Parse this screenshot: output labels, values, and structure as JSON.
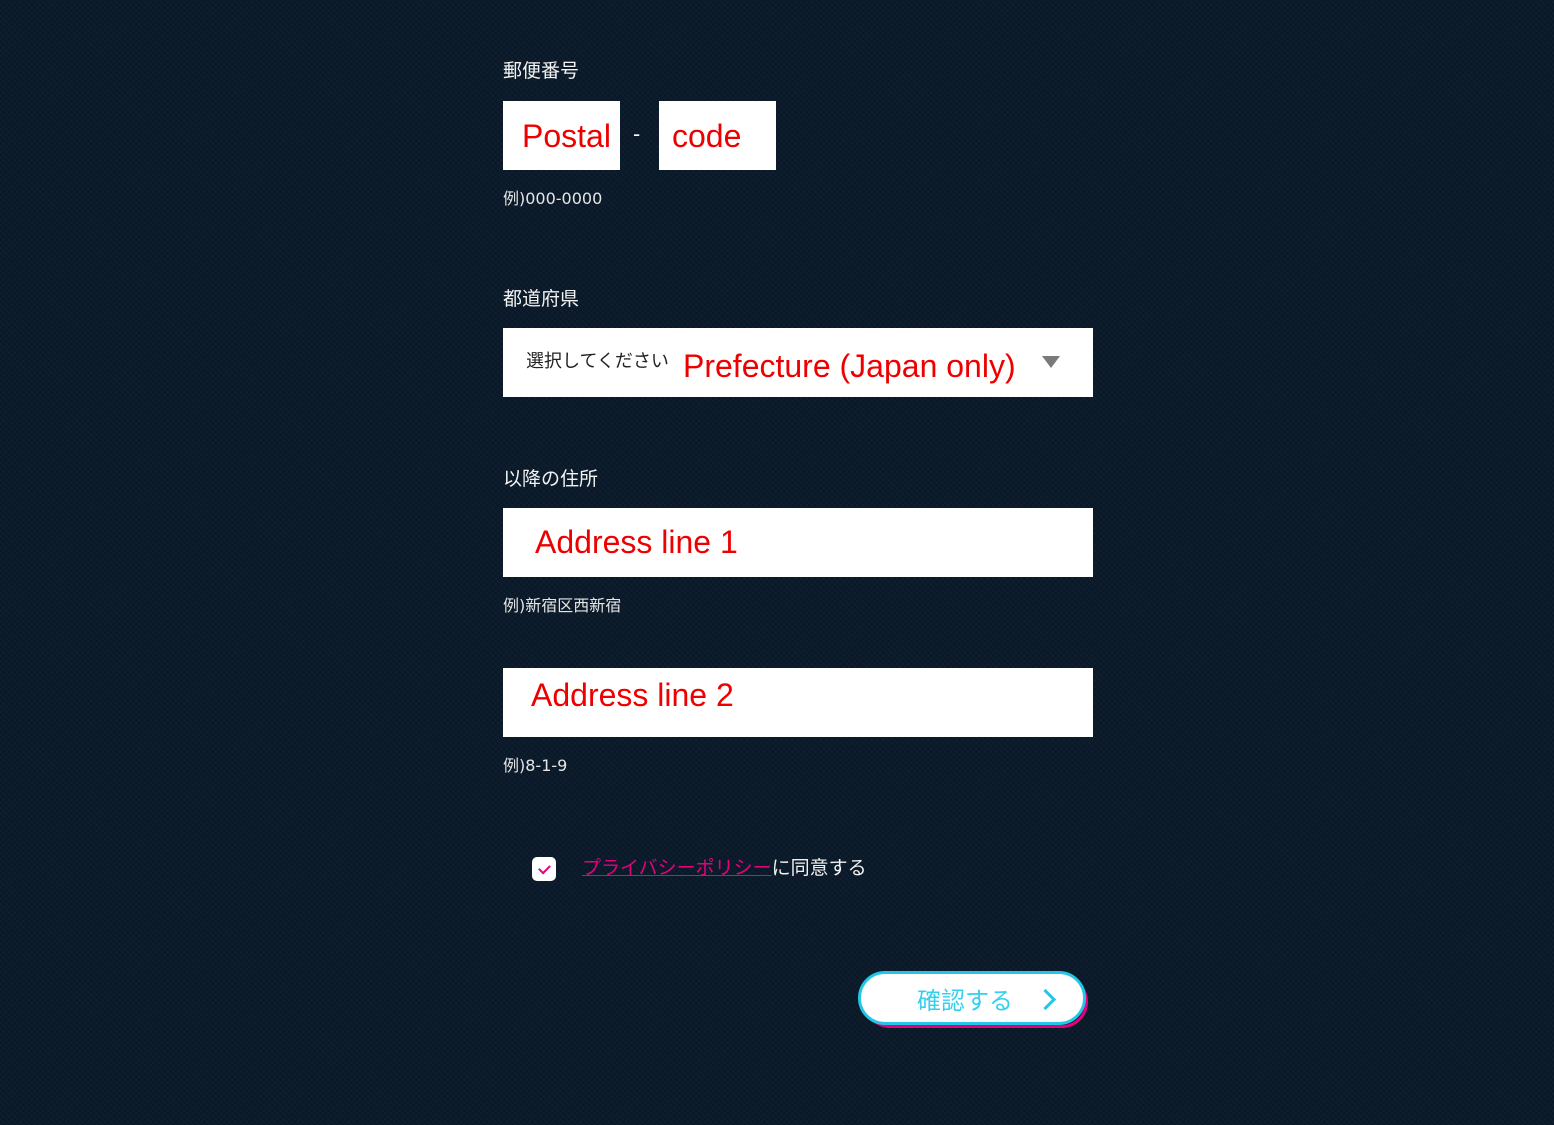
{
  "form": {
    "postal": {
      "label": "郵便番号",
      "part1_value": "Postal",
      "separator": "-",
      "part2_value": "code",
      "hint": "例)000-0000"
    },
    "prefecture": {
      "label": "都道府県",
      "placeholder": "選択してください",
      "value": "Prefecture (Japan only)",
      "dropdown_icon": "triangle-down-icon"
    },
    "address": {
      "label": "以降の住所",
      "line1_value": "Address line 1",
      "line1_hint": "例)新宿区西新宿",
      "line2_value": "Address line 2",
      "line2_hint": "例)8-1-9"
    },
    "privacy": {
      "checked": true,
      "link_text": "プライバシーポリシー",
      "suffix_text": "に同意する",
      "checkbox_icon": "checkmark-icon"
    },
    "submit": {
      "label": "確認する",
      "icon": "chevron-right-icon"
    }
  },
  "colors": {
    "background": "#0b1b2b",
    "accent_pink": "#e6007e",
    "accent_cyan": "#24c6e8",
    "annotation_red": "#ee0000"
  }
}
